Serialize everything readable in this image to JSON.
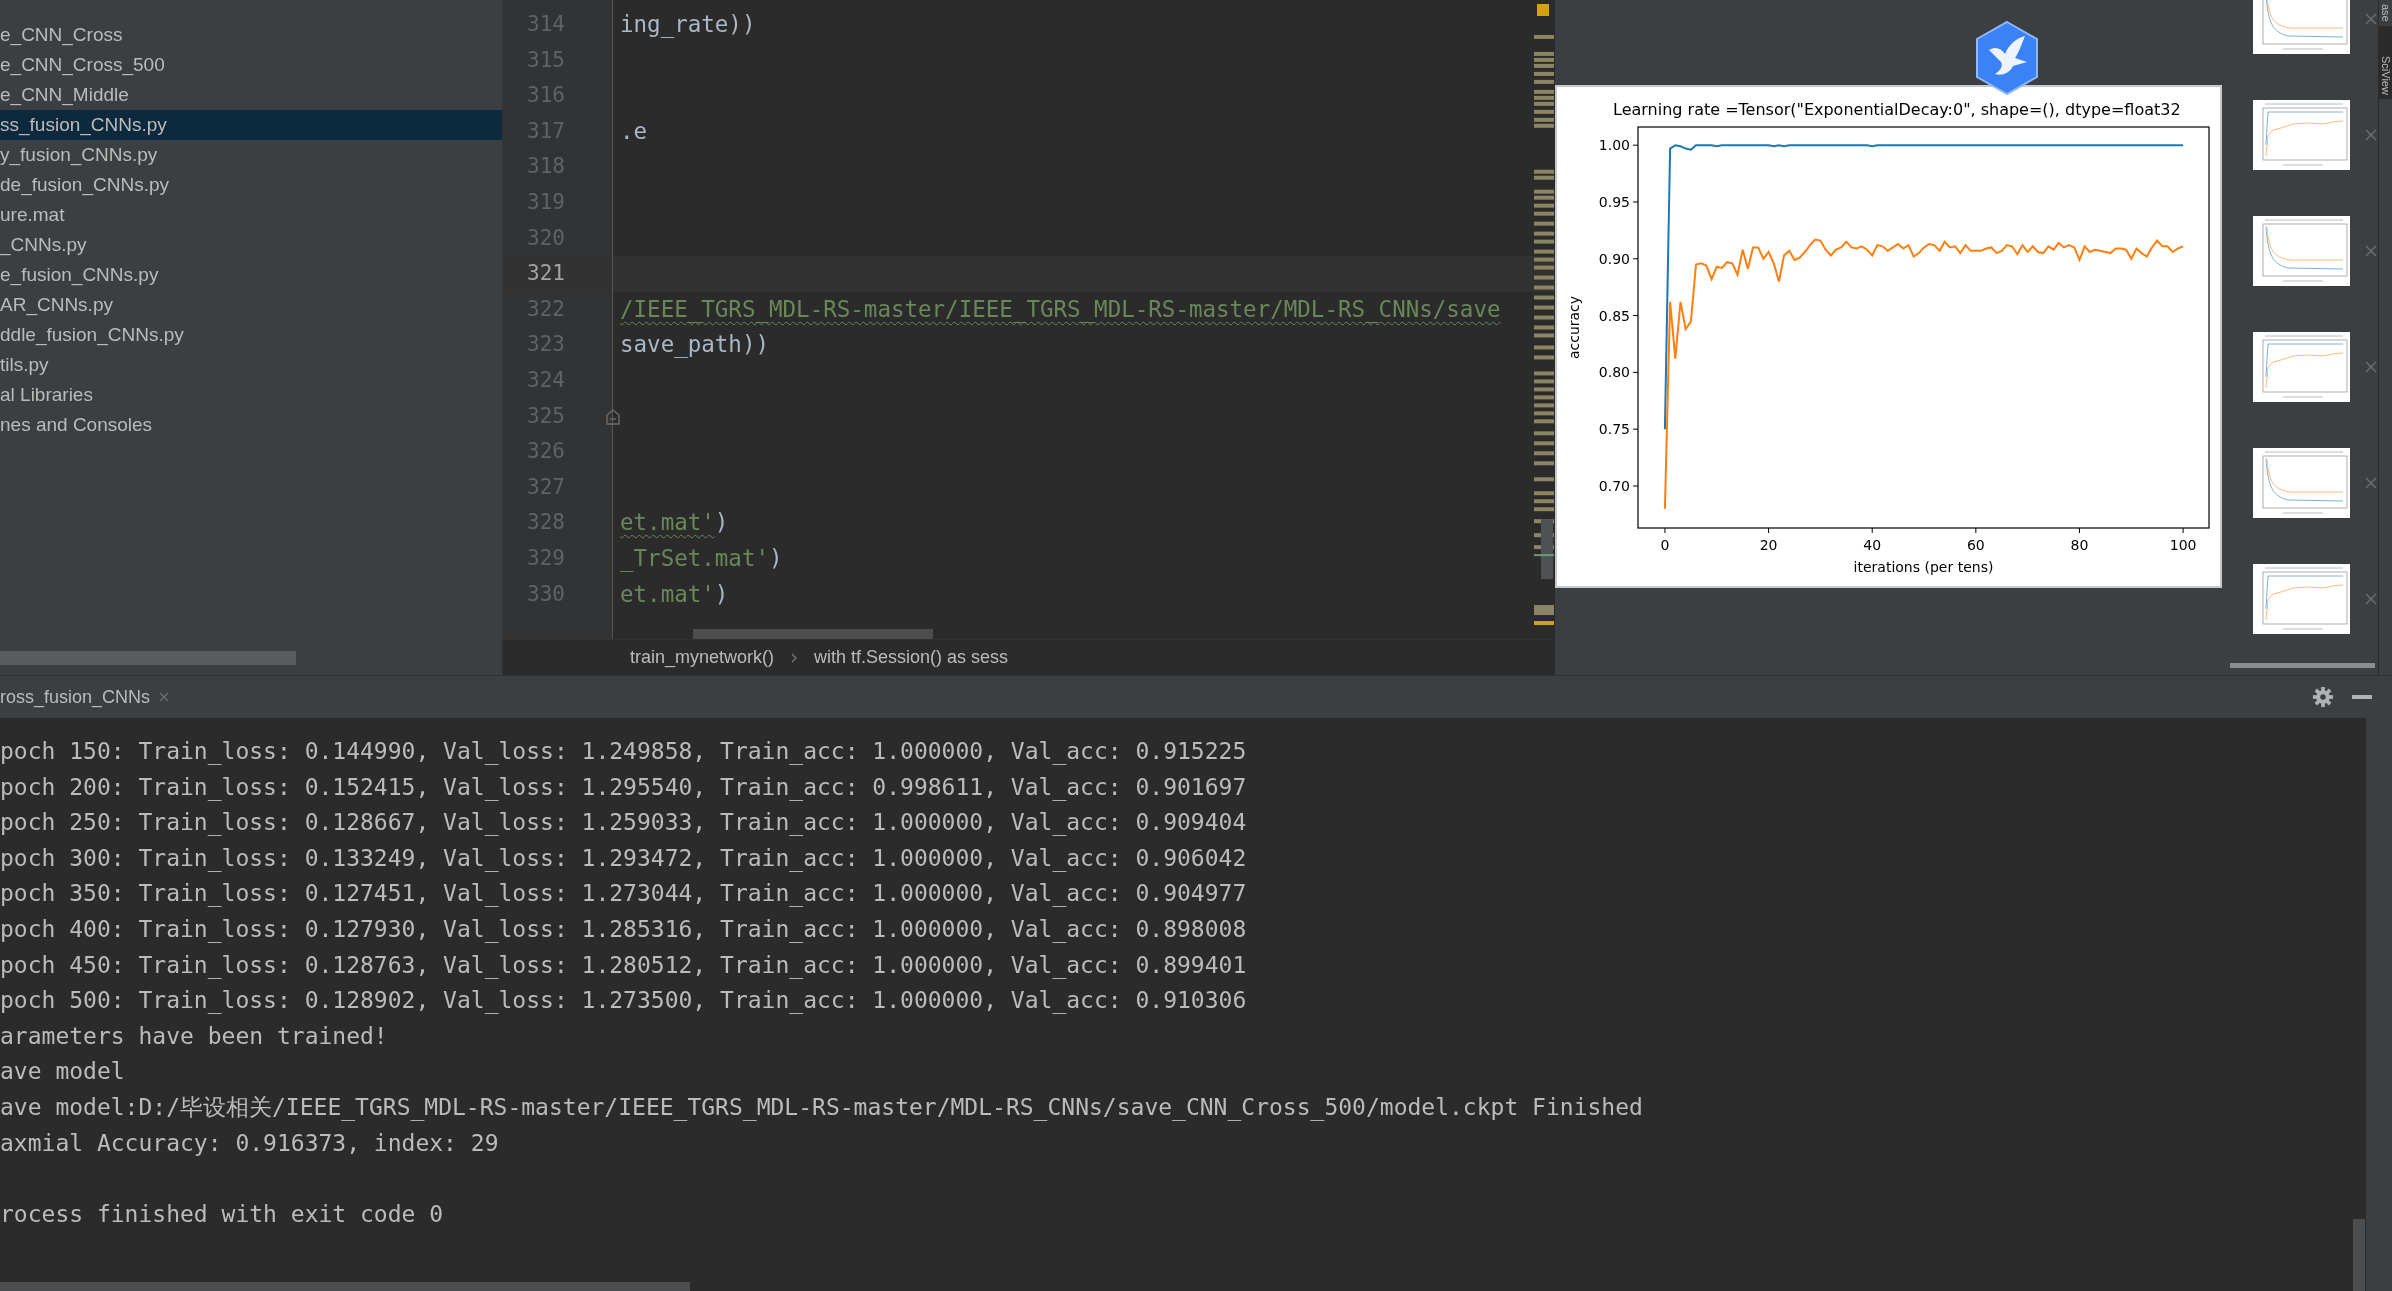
{
  "sidebar": {
    "items": [
      {
        "label": "e_CNN_Cross",
        "selected": false
      },
      {
        "label": "e_CNN_Cross_500",
        "selected": false
      },
      {
        "label": "e_CNN_Middle",
        "selected": false
      },
      {
        "label": "ss_fusion_CNNs.py",
        "selected": true
      },
      {
        "label": "y_fusion_CNNs.py",
        "selected": false
      },
      {
        "label": "de_fusion_CNNs.py",
        "selected": false
      },
      {
        "label": "ure.mat",
        "selected": false
      },
      {
        "label": "_CNNs.py",
        "selected": false
      },
      {
        "label": "e_fusion_CNNs.py",
        "selected": false
      },
      {
        "label": "AR_CNNs.py",
        "selected": false
      },
      {
        "label": "ddle_fusion_CNNs.py",
        "selected": false
      },
      {
        "label": "tils.py",
        "selected": false
      },
      {
        "label": "al Libraries",
        "selected": false
      },
      {
        "label": "nes and Consoles",
        "selected": false
      }
    ]
  },
  "editor": {
    "lines": [
      {
        "number": "314",
        "current": false,
        "segments": [
          {
            "text": "ing_rate))",
            "kind": "plain",
            "warning": false
          }
        ]
      },
      {
        "number": "315",
        "current": false
      },
      {
        "number": "316",
        "current": false
      },
      {
        "number": "317",
        "current": false,
        "segments": [
          {
            "text": ".e",
            "kind": "plain",
            "warning": false
          }
        ]
      },
      {
        "number": "318",
        "current": false
      },
      {
        "number": "319",
        "current": false
      },
      {
        "number": "320",
        "current": false
      },
      {
        "number": "321",
        "current": true
      },
      {
        "number": "322",
        "current": false,
        "segments": [
          {
            "text": "/IEEE_TGRS_MDL-RS-master/IEEE_TGRS_MDL-RS-master/MDL-RS_CNNs/save",
            "kind": "string",
            "warning": true
          }
        ]
      },
      {
        "number": "323",
        "current": false,
        "segments": [
          {
            "text": "save_path))",
            "kind": "plain",
            "warning": false
          }
        ]
      },
      {
        "number": "324",
        "current": false
      },
      {
        "number": "325",
        "current": false,
        "fold": true
      },
      {
        "number": "326",
        "current": false
      },
      {
        "number": "327",
        "current": false
      },
      {
        "number": "328",
        "current": false,
        "segments": [
          {
            "text": "et.mat'",
            "kind": "string",
            "warning": true
          },
          {
            "text": ")",
            "kind": "plain",
            "warning": false
          }
        ]
      },
      {
        "number": "329",
        "current": false,
        "segments": [
          {
            "text": "_TrSet.mat'",
            "kind": "string",
            "warning": false
          },
          {
            "text": ")",
            "kind": "plain",
            "warning": false
          }
        ]
      },
      {
        "number": "330",
        "current": false,
        "segments": [
          {
            "text": "et.mat'",
            "kind": "string",
            "warning": false
          },
          {
            "text": ")",
            "kind": "plain",
            "warning": false
          }
        ]
      }
    ],
    "breadcrumbs": [
      "train_mynetwork()",
      "with tf.Session() as sess"
    ]
  },
  "plot": {
    "chart_data": {
      "type": "line",
      "title": "Learning rate =Tensor(\"ExponentialDecay:0\", shape=(), dtype=float32",
      "xlabel": "iterations (per tens)",
      "ylabel": "accuracy",
      "x": [
        0,
        1,
        2,
        3,
        4,
        5,
        6,
        7,
        8,
        9,
        10,
        11,
        12,
        13,
        14,
        15,
        16,
        17,
        18,
        19,
        20,
        21,
        22,
        23,
        24,
        25,
        26,
        27,
        28,
        29,
        30,
        31,
        32,
        33,
        34,
        35,
        36,
        37,
        38,
        39,
        40,
        41,
        42,
        43,
        44,
        45,
        46,
        47,
        48,
        49,
        50,
        51,
        52,
        53,
        54,
        55,
        56,
        57,
        58,
        59,
        60,
        61,
        62,
        63,
        64,
        65,
        66,
        67,
        68,
        69,
        70,
        71,
        72,
        73,
        74,
        75,
        76,
        77,
        78,
        79,
        80,
        81,
        82,
        83,
        84,
        85,
        86,
        87,
        88,
        89,
        90,
        91,
        92,
        93,
        94,
        95,
        96,
        97,
        98,
        99,
        100
      ],
      "series": [
        {
          "color": "#1f77b4",
          "values": [
            0.75,
            0.997,
            1.0,
            0.999,
            0.997,
            0.996,
            1.0,
            1.0,
            1.0,
            1.0,
            0.999,
            1.0,
            1.0,
            1.0,
            1.0,
            1.0,
            1.0,
            1.0,
            1.0,
            1.0,
            1.0,
            0.999,
            1.0,
            0.999,
            1.0,
            1.0,
            1.0,
            1.0,
            1.0,
            1.0,
            1.0,
            1.0,
            1.0,
            1.0,
            1.0,
            1.0,
            1.0,
            1.0,
            1.0,
            1.0,
            0.999,
            1.0,
            1.0,
            1.0,
            1.0,
            1.0,
            1.0,
            1.0,
            1.0,
            1.0,
            1.0,
            1.0,
            1.0,
            1.0,
            1.0,
            1.0,
            1.0,
            1.0,
            1.0,
            1.0,
            1.0,
            1.0,
            1.0,
            1.0,
            1.0,
            1.0,
            1.0,
            1.0,
            1.0,
            1.0,
            1.0,
            1.0,
            1.0,
            1.0,
            1.0,
            1.0,
            1.0,
            1.0,
            1.0,
            1.0,
            1.0,
            1.0,
            1.0,
            1.0,
            1.0,
            1.0,
            1.0,
            1.0,
            1.0,
            1.0,
            1.0,
            1.0,
            1.0,
            1.0,
            1.0,
            1.0,
            1.0,
            1.0,
            1.0,
            1.0,
            1.0
          ]
        },
        {
          "color": "#ff7f0e",
          "values": [
            0.68,
            0.862,
            0.812,
            0.862,
            0.838,
            0.845,
            0.895,
            0.896,
            0.894,
            0.882,
            0.893,
            0.892,
            0.897,
            0.896,
            0.886,
            0.908,
            0.891,
            0.91,
            0.91,
            0.9,
            0.906,
            0.896,
            0.88,
            0.903,
            0.907,
            0.899,
            0.901,
            0.906,
            0.912,
            0.917,
            0.916,
            0.908,
            0.903,
            0.908,
            0.91,
            0.915,
            0.91,
            0.909,
            0.911,
            0.908,
            0.903,
            0.912,
            0.911,
            0.907,
            0.91,
            0.913,
            0.909,
            0.912,
            0.902,
            0.905,
            0.91,
            0.913,
            0.912,
            0.907,
            0.915,
            0.91,
            0.911,
            0.905,
            0.912,
            0.907,
            0.907,
            0.907,
            0.909,
            0.91,
            0.905,
            0.907,
            0.912,
            0.911,
            0.904,
            0.912,
            0.906,
            0.911,
            0.906,
            0.905,
            0.911,
            0.908,
            0.914,
            0.91,
            0.912,
            0.91,
            0.899,
            0.911,
            0.906,
            0.908,
            0.907,
            0.906,
            0.905,
            0.909,
            0.909,
            0.908,
            0.9,
            0.909,
            0.905,
            0.902,
            0.91,
            0.916,
            0.911,
            0.911,
            0.906,
            0.909,
            0.911
          ]
        }
      ],
      "xlim": [
        -5.2,
        105
      ],
      "ylim": [
        0.663,
        1.016
      ],
      "xticks": [
        0,
        20,
        40,
        60,
        80,
        100
      ],
      "yticks": [
        {
          "value": 0.7,
          "label": "0.70"
        },
        {
          "value": 0.75,
          "label": "0.75"
        },
        {
          "value": 0.8,
          "label": "0.80"
        },
        {
          "value": 0.85,
          "label": "0.85"
        },
        {
          "value": 0.9,
          "label": "0.90"
        },
        {
          "value": 0.95,
          "label": "0.95"
        },
        {
          "value": 1.0,
          "label": "1.00"
        }
      ]
    }
  },
  "thumbnails": [
    {
      "kind": "loss"
    },
    {
      "kind": "accuracy"
    },
    {
      "kind": "loss"
    },
    {
      "kind": "accuracy"
    },
    {
      "kind": "loss"
    },
    {
      "kind": "accuracy"
    }
  ],
  "tool_strip": {
    "tabs": [
      {
        "label": "ase",
        "selected": false
      },
      {
        "label": "SciView",
        "selected": true
      }
    ]
  },
  "console": {
    "tab": "ross_fusion_CNNs",
    "lines": [
      "poch 150: Train_loss: 0.144990, Val_loss: 1.249858, Train_acc: 1.000000, Val_acc: 0.915225",
      "poch 200: Train_loss: 0.152415, Val_loss: 1.295540, Train_acc: 0.998611, Val_acc: 0.901697",
      "poch 250: Train_loss: 0.128667, Val_loss: 1.259033, Train_acc: 1.000000, Val_acc: 0.909404",
      "poch 300: Train_loss: 0.133249, Val_loss: 1.293472, Train_acc: 1.000000, Val_acc: 0.906042",
      "poch 350: Train_loss: 0.127451, Val_loss: 1.273044, Train_acc: 1.000000, Val_acc: 0.904977",
      "poch 400: Train_loss: 0.127930, Val_loss: 1.285316, Train_acc: 1.000000, Val_acc: 0.898008",
      "poch 450: Train_loss: 0.128763, Val_loss: 1.280512, Train_acc: 1.000000, Val_acc: 0.899401",
      "poch 500: Train_loss: 0.128902, Val_loss: 1.273500, Train_acc: 1.000000, Val_acc: 0.910306",
      "arameters have been trained!",
      "ave model",
      "ave model:D:/毕设相关/IEEE_TGRS_MDL-RS-master/IEEE_TGRS_MDL-RS-master/MDL-RS_CNNs/save_CNN_Cross_500/model.ckpt Finished",
      "axmial Accuracy: 0.916373, index: 29"
    ],
    "exit_message": "rocess finished with exit code 0"
  }
}
